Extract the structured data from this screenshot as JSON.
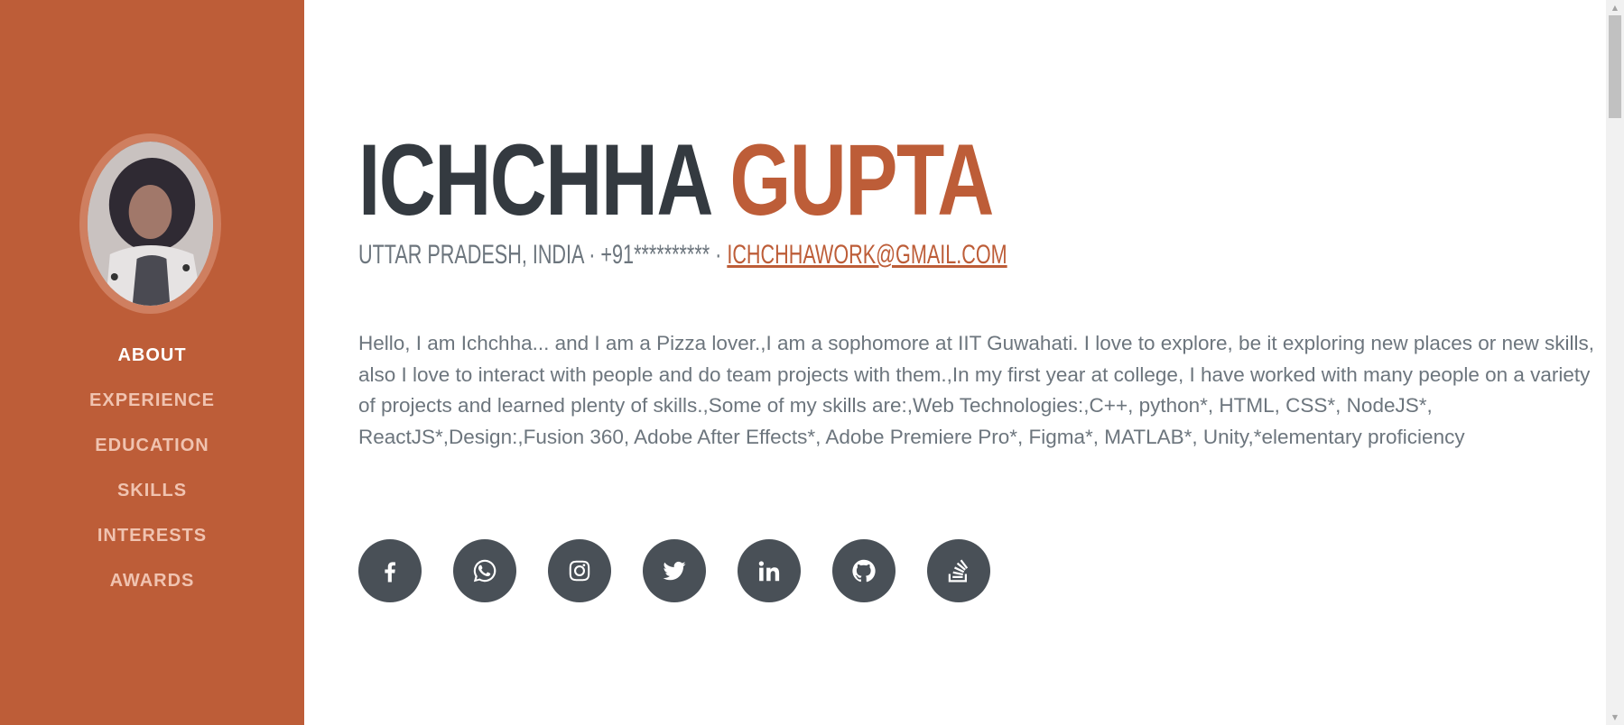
{
  "sidebar": {
    "avatar_alt": "profile photo",
    "nav": [
      {
        "label": "ABOUT",
        "active": true
      },
      {
        "label": "EXPERIENCE",
        "active": false
      },
      {
        "label": "EDUCATION",
        "active": false
      },
      {
        "label": "SKILLS",
        "active": false
      },
      {
        "label": "INTERESTS",
        "active": false
      },
      {
        "label": "AWARDS",
        "active": false
      }
    ]
  },
  "about": {
    "first_name": "ICHCHHA",
    "last_name": "GUPTA",
    "subheading_prefix": "UTTAR PRADESH, INDIA · +91********** · ",
    "email": "ICHCHHAWORK@GMAIL.COM",
    "lead": "Hello, I am Ichchha... and I am a Pizza lover.,I am a sophomore at IIT Guwahati. I love to explore, be it exploring new places or new skills, also I love to interact with people and do team projects with them.,In my first year at college, I have worked with many people on a variety of projects and learned plenty of skills.,Some of my skills are:,Web Technologies:,C++, python*, HTML, CSS*, NodeJS*, ReactJS*,Design:,Fusion 360, Adobe After Effects*, Adobe Premiere Pro*, Figma*, MATLAB*, Unity,*elementary proficiency"
  },
  "social_icons": [
    "facebook-icon",
    "whatsapp-icon",
    "instagram-icon",
    "twitter-icon",
    "linkedin-icon",
    "github-icon",
    "stackoverflow-icon"
  ],
  "colors": {
    "primary": "#bd5d38",
    "dark": "#343a40",
    "muted": "#6c757d",
    "social_bg": "#495057"
  }
}
